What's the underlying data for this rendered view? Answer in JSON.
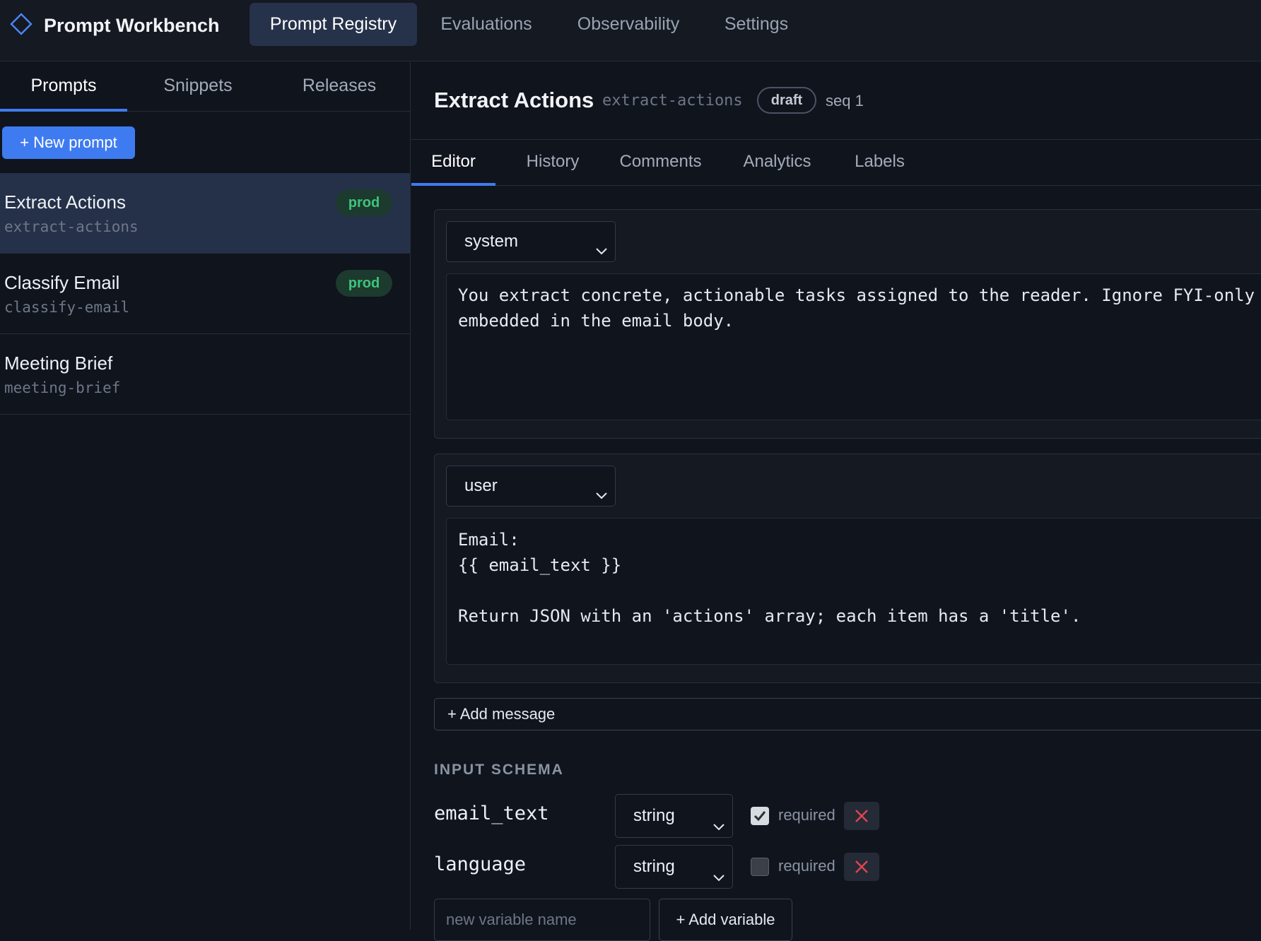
{
  "app": {
    "name": "Prompt Workbench",
    "nav": [
      "Prompt Registry",
      "Evaluations",
      "Observability",
      "Settings"
    ],
    "active_nav": "Prompt Registry"
  },
  "sidebar": {
    "tabs": [
      "Prompts",
      "Snippets",
      "Releases"
    ],
    "active_tab": "Prompts",
    "new_prompt_label": "+ New prompt",
    "prompts": [
      {
        "name": "Extract Actions",
        "slug": "extract-actions",
        "badge": "prod",
        "selected": true
      },
      {
        "name": "Classify Email",
        "slug": "classify-email",
        "badge": "prod",
        "selected": false
      },
      {
        "name": "Meeting Brief",
        "slug": "meeting-brief",
        "badge": "",
        "selected": false
      }
    ]
  },
  "prompt": {
    "title": "Extract Actions",
    "slug": "extract-actions",
    "status": "draft",
    "seq": "seq 1"
  },
  "editor_tabs": [
    "Editor",
    "History",
    "Comments",
    "Analytics",
    "Labels"
  ],
  "active_editor_tab": "Editor",
  "messages": [
    {
      "role": "system",
      "content": "You extract concrete, actionable tasks assigned to the reader. Ignore FYI-only\nembedded in the email body."
    },
    {
      "role": "user",
      "content": "Email:\n{{ email_text }}\n\nReturn JSON with an 'actions' array; each item has a 'title'."
    }
  ],
  "add_message_label": "+ Add message",
  "schema": {
    "heading": "INPUT SCHEMA",
    "variables": [
      {
        "name": "email_text",
        "type": "string",
        "required": true
      },
      {
        "name": "language",
        "type": "string",
        "required": false
      }
    ],
    "required_label": "required",
    "new_variable_placeholder": "new variable name",
    "add_variable_label": "+ Add variable"
  },
  "colors": {
    "background": "#10141d",
    "accent": "#3f7bf0",
    "prod_badge": "#3fc47c",
    "danger": "#e0454f"
  }
}
